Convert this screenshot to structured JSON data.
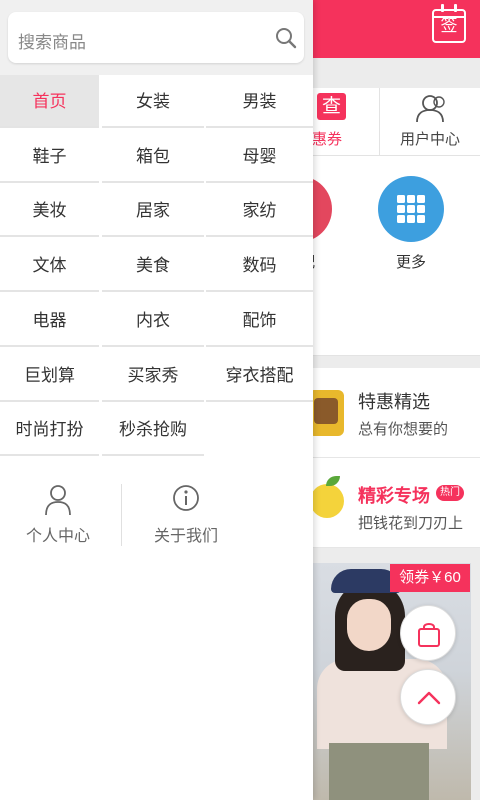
{
  "background": {
    "sign_icon_glyph": "签",
    "nav": {
      "coupon_glyph": "查",
      "coupon_label": "优惠券",
      "user_center_label": "用户中心"
    },
    "circles": {
      "peijian_label": "配",
      "more_label": "更多"
    },
    "promos": [
      {
        "title": "特惠精选",
        "subtitle": "总有你想要的"
      },
      {
        "title": "精彩专场",
        "badge": "热门",
        "subtitle": "把钱花到刀刃上"
      }
    ],
    "voucher_label": "领券￥60",
    "colors": {
      "accent": "#f5325c",
      "more_circle": "#3d9fdf"
    }
  },
  "drawer": {
    "search": {
      "placeholder": "搜索商品"
    },
    "categories": [
      "首页",
      "女装",
      "男装",
      "鞋子",
      "箱包",
      "母婴",
      "美妆",
      "居家",
      "家纺",
      "文体",
      "美食",
      "数码",
      "电器",
      "内衣",
      "配饰",
      "巨划算",
      "买家秀",
      "穿衣搭配",
      "时尚打扮",
      "秒杀抢购"
    ],
    "active_category": "首页",
    "links": {
      "profile": "个人中心",
      "about": "关于我们"
    }
  }
}
